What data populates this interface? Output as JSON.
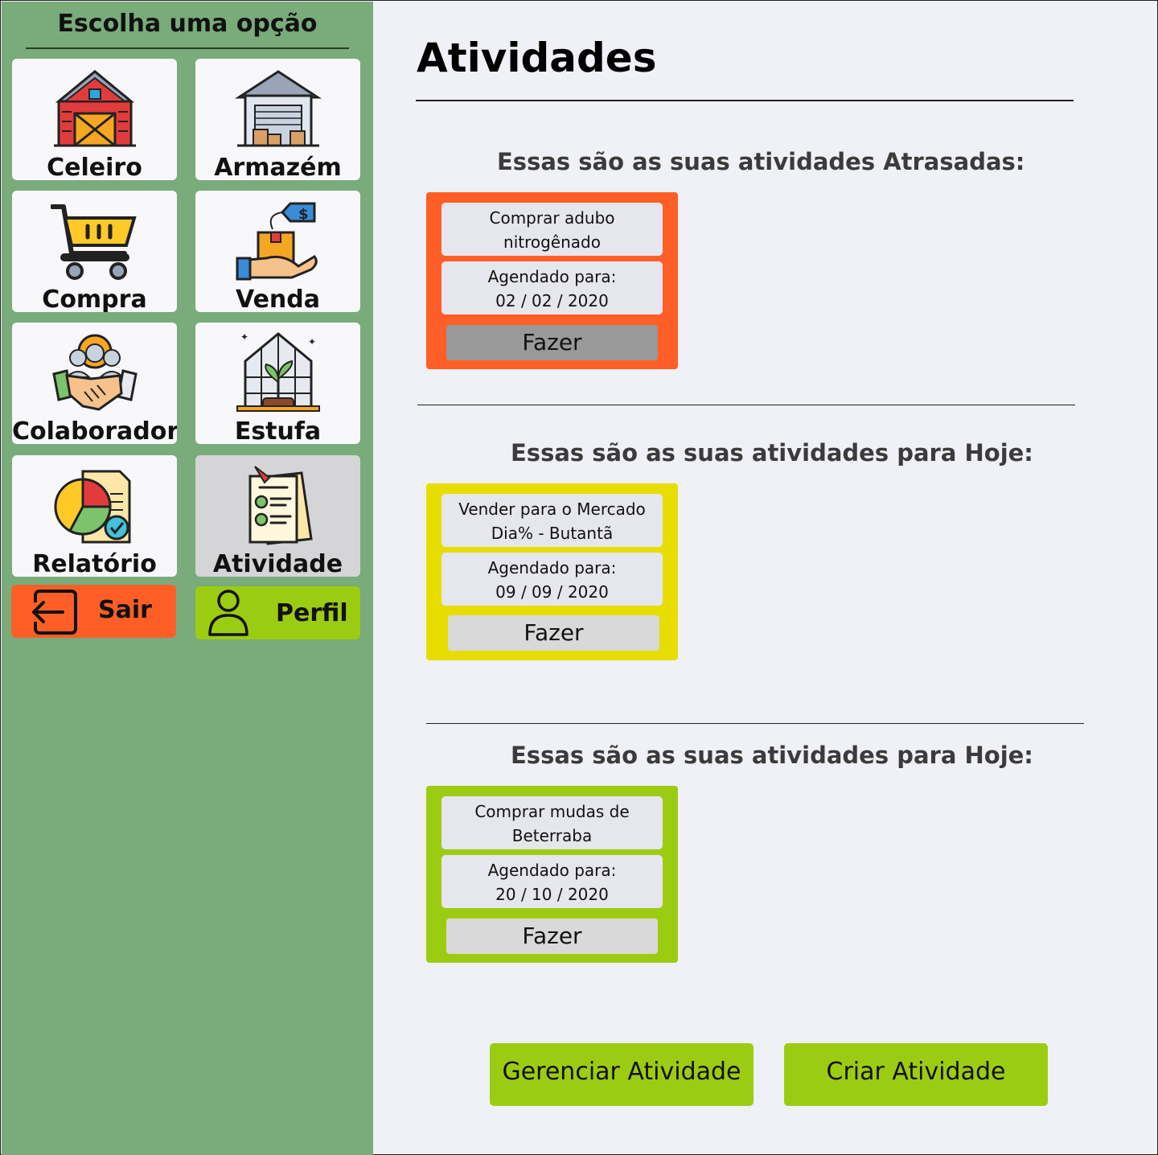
{
  "sidebar": {
    "title": "Escolha uma opção",
    "tiles": [
      {
        "label": "Celeiro",
        "icon": "barn-icon"
      },
      {
        "label": "Armazém",
        "icon": "warehouse-icon"
      },
      {
        "label": "Compra",
        "icon": "shopping-cart-icon"
      },
      {
        "label": "Venda",
        "icon": "sale-hand-box-icon"
      },
      {
        "label": "Colaborador",
        "icon": "handshake-team-icon"
      },
      {
        "label": "Estufa",
        "icon": "greenhouse-icon"
      },
      {
        "label": "Relatório",
        "icon": "report-chart-icon"
      },
      {
        "label": "Atividade",
        "icon": "checklist-icon"
      }
    ],
    "logout_label": "Sair",
    "profile_label": "Perfil"
  },
  "main": {
    "title": "Atividades",
    "sections": [
      {
        "heading": "Essas são as suas atividades Atrasadas:",
        "card": {
          "task_line1": "Comprar adubo",
          "task_line2": "nitrogênado",
          "scheduled_label": "Agendado para:",
          "date": "02 / 02 / 2020",
          "button": "Fazer"
        }
      },
      {
        "heading": "Essas são as suas atividades para Hoje:",
        "card": {
          "task_line1": "Vender para o Mercado",
          "task_line2": "Dia% - Butantã",
          "scheduled_label": "Agendado para:",
          "date": "09 / 09 / 2020",
          "button": "Fazer"
        }
      },
      {
        "heading": "Essas são as suas atividades para Hoje:",
        "card": {
          "task_line1": "Comprar mudas de",
          "task_line2": "Beterraba",
          "scheduled_label": "Agendado para:",
          "date": "20 / 10 / 2020",
          "button": "Fazer"
        }
      }
    ],
    "manage_button": "Gerenciar Atividade",
    "create_button": "Criar Atividade"
  },
  "colors": {
    "sidebar_bg": "#79ab7b",
    "late": "#ff5f26",
    "today": "#e8dd00",
    "upcoming": "#9ccc12",
    "logout": "#ff5f26",
    "profile": "#9ccc12"
  }
}
